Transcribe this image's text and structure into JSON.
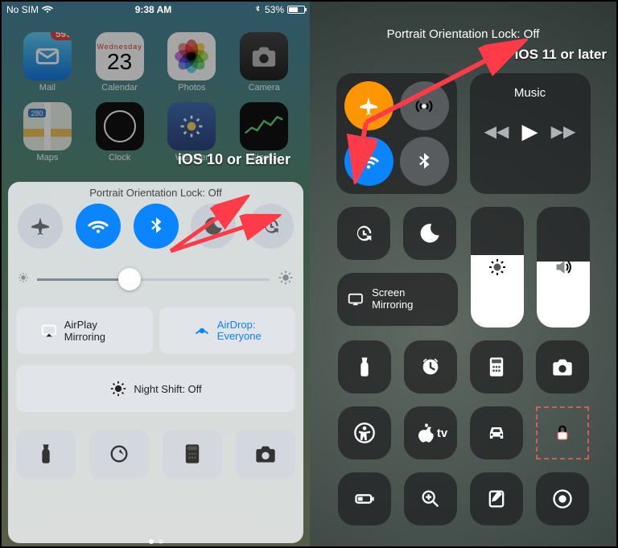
{
  "left": {
    "status": {
      "carrier": "No SIM",
      "time": "9:38 AM",
      "battery": "53%"
    },
    "apps_row1": [
      {
        "label": "Mail",
        "badge": "595"
      },
      {
        "label": "Calendar",
        "dow": "Wednesday",
        "day": "23"
      },
      {
        "label": "Photos"
      },
      {
        "label": "Camera"
      }
    ],
    "apps_row2": [
      {
        "label": "Maps"
      },
      {
        "label": "Clock"
      },
      {
        "label": "Weather"
      },
      {
        "label": "Stocks"
      }
    ],
    "annotation": "iOS 10 or Earlier",
    "cc": {
      "header": "Portrait Orientation Lock: Off",
      "airplay": "AirPlay Mirroring",
      "airdrop_l1": "AirDrop:",
      "airdrop_l2": "Everyone",
      "nightshift": "Night Shift: Off"
    }
  },
  "right": {
    "header": "Portrait Orientation Lock: Off",
    "annotation": "iOS 11 or later",
    "music_title": "Music",
    "screen_mirror": "Screen Mirroring",
    "tv_label": "tv",
    "brightness_level": 60,
    "volume_level": 55
  }
}
